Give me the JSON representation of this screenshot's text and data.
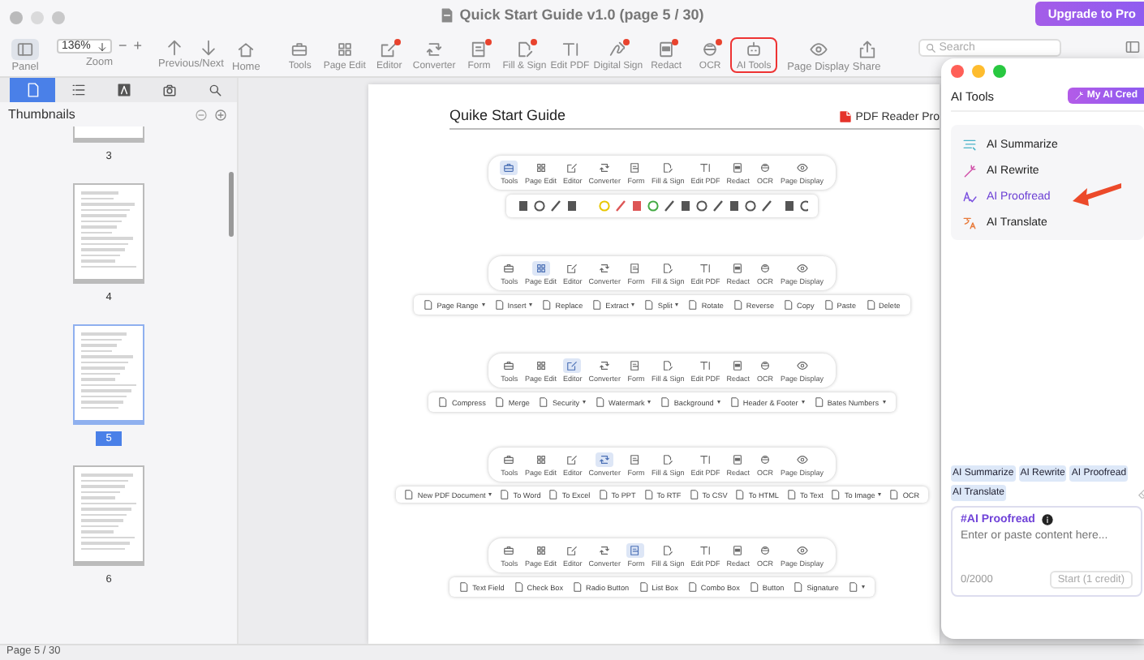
{
  "window": {
    "title": "Quick Start Guide v1.0 (page 5 / 30)",
    "upgrade_button": "Upgrade to Pro"
  },
  "toolbar": {
    "panel": {
      "label": "Panel",
      "selected": true
    },
    "zoom": {
      "value": "136%",
      "minus": "−",
      "plus": "+",
      "label": "Zoom"
    },
    "navigation": {
      "label": "Previous/Next"
    },
    "home": {
      "label": "Home"
    },
    "tools": [
      {
        "label": "Tools",
        "dot": false,
        "highlighted": false
      },
      {
        "label": "Page Edit",
        "dot": false,
        "highlighted": false
      },
      {
        "label": "Editor",
        "dot": true,
        "highlighted": false
      },
      {
        "label": "Converter",
        "dot": false,
        "highlighted": false
      },
      {
        "label": "Form",
        "dot": true,
        "highlighted": false
      },
      {
        "label": "Fill & Sign",
        "dot": true,
        "highlighted": false
      },
      {
        "label": "Edit PDF",
        "dot": false,
        "highlighted": false
      },
      {
        "label": "Digital Sign",
        "dot": true,
        "highlighted": false
      },
      {
        "label": "Redact",
        "dot": true,
        "highlighted": false
      },
      {
        "label": "OCR",
        "dot": true,
        "highlighted": false
      },
      {
        "label": "AI Tools",
        "dot": false,
        "highlighted": true
      }
    ],
    "view": [
      {
        "label": "Page Display"
      },
      {
        "label": "Share"
      }
    ],
    "search": {
      "placeholder": "Search"
    }
  },
  "sidebar": {
    "tabs": [
      {
        "selected": true
      },
      {
        "selected": false
      },
      {
        "selected": false
      },
      {
        "selected": false
      },
      {
        "selected": false
      }
    ],
    "title": "Thumbnails",
    "thumbnails": [
      {
        "label": "3",
        "selected": false
      },
      {
        "label": "4",
        "selected": false
      },
      {
        "label": "5",
        "selected": true
      },
      {
        "label": "6",
        "selected": false
      }
    ]
  },
  "document": {
    "heading": "Quike Start Guide",
    "brand": "PDF Reader Pro",
    "sections": [
      {
        "nav": [
          {
            "label": "Tools",
            "selected": true
          },
          {
            "label": "Page Edit",
            "selected": false
          },
          {
            "label": "Editor",
            "selected": false
          },
          {
            "label": "Converter",
            "selected": false
          },
          {
            "label": "Form",
            "selected": false
          },
          {
            "label": "Fill & Sign",
            "selected": false
          },
          {
            "label": "Edit PDF",
            "selected": false
          },
          {
            "label": "Redact",
            "selected": false
          },
          {
            "label": "OCR",
            "selected": false
          },
          {
            "label": "Page Display",
            "selected": false
          }
        ],
        "kind": "icons"
      },
      {
        "nav": [
          {
            "label": "Tools",
            "selected": false
          },
          {
            "label": "Page Edit",
            "selected": true
          },
          {
            "label": "Editor",
            "selected": false
          },
          {
            "label": "Converter",
            "selected": false
          },
          {
            "label": "Form",
            "selected": false
          },
          {
            "label": "Fill & Sign",
            "selected": false
          },
          {
            "label": "Edit PDF",
            "selected": false
          },
          {
            "label": "Redact",
            "selected": false
          },
          {
            "label": "OCR",
            "selected": false
          },
          {
            "label": "Page Display",
            "selected": false
          }
        ],
        "kind": "buttons",
        "items": [
          {
            "label": "Page Range",
            "menu": true
          },
          {
            "label": "Insert",
            "menu": true
          },
          {
            "label": "Replace",
            "menu": false
          },
          {
            "label": "Extract",
            "menu": true
          },
          {
            "label": "Split",
            "menu": true
          },
          {
            "label": "Rotate",
            "menu": false
          },
          {
            "label": "Reverse",
            "menu": false
          },
          {
            "label": "Copy",
            "menu": false
          },
          {
            "label": "Paste",
            "menu": false
          },
          {
            "label": "Delete",
            "menu": false
          }
        ]
      },
      {
        "nav": [
          {
            "label": "Tools",
            "selected": false
          },
          {
            "label": "Page Edit",
            "selected": false
          },
          {
            "label": "Editor",
            "selected": true
          },
          {
            "label": "Converter",
            "selected": false
          },
          {
            "label": "Form",
            "selected": false
          },
          {
            "label": "Fill & Sign",
            "selected": false
          },
          {
            "label": "Edit PDF",
            "selected": false
          },
          {
            "label": "Redact",
            "selected": false
          },
          {
            "label": "OCR",
            "selected": false
          },
          {
            "label": "Page Display",
            "selected": false
          }
        ],
        "kind": "buttons",
        "items": [
          {
            "label": "Compress",
            "menu": false
          },
          {
            "label": "Merge",
            "menu": false
          },
          {
            "label": "Security",
            "menu": true
          },
          {
            "label": "Watermark",
            "menu": true
          },
          {
            "label": "Background",
            "menu": true
          },
          {
            "label": "Header & Footer",
            "menu": true
          },
          {
            "label": "Bates Numbers",
            "menu": true
          }
        ]
      },
      {
        "nav": [
          {
            "label": "Tools",
            "selected": false
          },
          {
            "label": "Page Edit",
            "selected": false
          },
          {
            "label": "Editor",
            "selected": false
          },
          {
            "label": "Converter",
            "selected": true
          },
          {
            "label": "Form",
            "selected": false
          },
          {
            "label": "Fill & Sign",
            "selected": false
          },
          {
            "label": "Edit PDF",
            "selected": false
          },
          {
            "label": "Redact",
            "selected": false
          },
          {
            "label": "OCR",
            "selected": false
          },
          {
            "label": "Page Display",
            "selected": false
          }
        ],
        "kind": "buttons",
        "items": [
          {
            "label": "New PDF Document",
            "menu": true
          },
          {
            "label": "To Word",
            "menu": false
          },
          {
            "label": "To Excel",
            "menu": false
          },
          {
            "label": "To PPT",
            "menu": false
          },
          {
            "label": "To RTF",
            "menu": false
          },
          {
            "label": "To CSV",
            "menu": false
          },
          {
            "label": "To HTML",
            "menu": false
          },
          {
            "label": "To Text",
            "menu": false
          },
          {
            "label": "To Image",
            "menu": true
          },
          {
            "label": "OCR",
            "menu": false
          }
        ]
      },
      {
        "nav": [
          {
            "label": "Tools",
            "selected": false
          },
          {
            "label": "Page Edit",
            "selected": false
          },
          {
            "label": "Editor",
            "selected": false
          },
          {
            "label": "Converter",
            "selected": false
          },
          {
            "label": "Form",
            "selected": true
          },
          {
            "label": "Fill & Sign",
            "selected": false
          },
          {
            "label": "Edit PDF",
            "selected": false
          },
          {
            "label": "Redact",
            "selected": false
          },
          {
            "label": "OCR",
            "selected": false
          },
          {
            "label": "Page Display",
            "selected": false
          }
        ],
        "kind": "buttons",
        "items": [
          {
            "label": "Text Field",
            "menu": false
          },
          {
            "label": "Check Box",
            "menu": false
          },
          {
            "label": "Radio Button",
            "menu": false
          },
          {
            "label": "List Box",
            "menu": false
          },
          {
            "label": "Combo Box",
            "menu": false
          },
          {
            "label": "Button",
            "menu": false
          },
          {
            "label": "Signature",
            "menu": false
          },
          {
            "menu": true
          }
        ]
      }
    ]
  },
  "ai_panel": {
    "title": "AI Tools",
    "credits_button": "My AI Cred",
    "items": [
      {
        "label": "AI Summarize",
        "selected": false
      },
      {
        "label": "AI Rewrite",
        "selected": false
      },
      {
        "label": "AI Proofread",
        "selected": true
      },
      {
        "label": "AI Translate",
        "selected": false
      }
    ],
    "chips": [
      {
        "label": "AI Summarize"
      },
      {
        "label": "AI Rewrite"
      },
      {
        "label": "AI Proofread"
      },
      {
        "label": "AI Translate"
      }
    ],
    "composer": {
      "tag": "#AI Proofread",
      "placeholder": "Enter or paste content here...",
      "counter": "0/2000",
      "submit": {
        "label": "Start (1 credit)",
        "disabled": true
      }
    }
  },
  "status_bar": {
    "text": "Page 5 / 30"
  }
}
